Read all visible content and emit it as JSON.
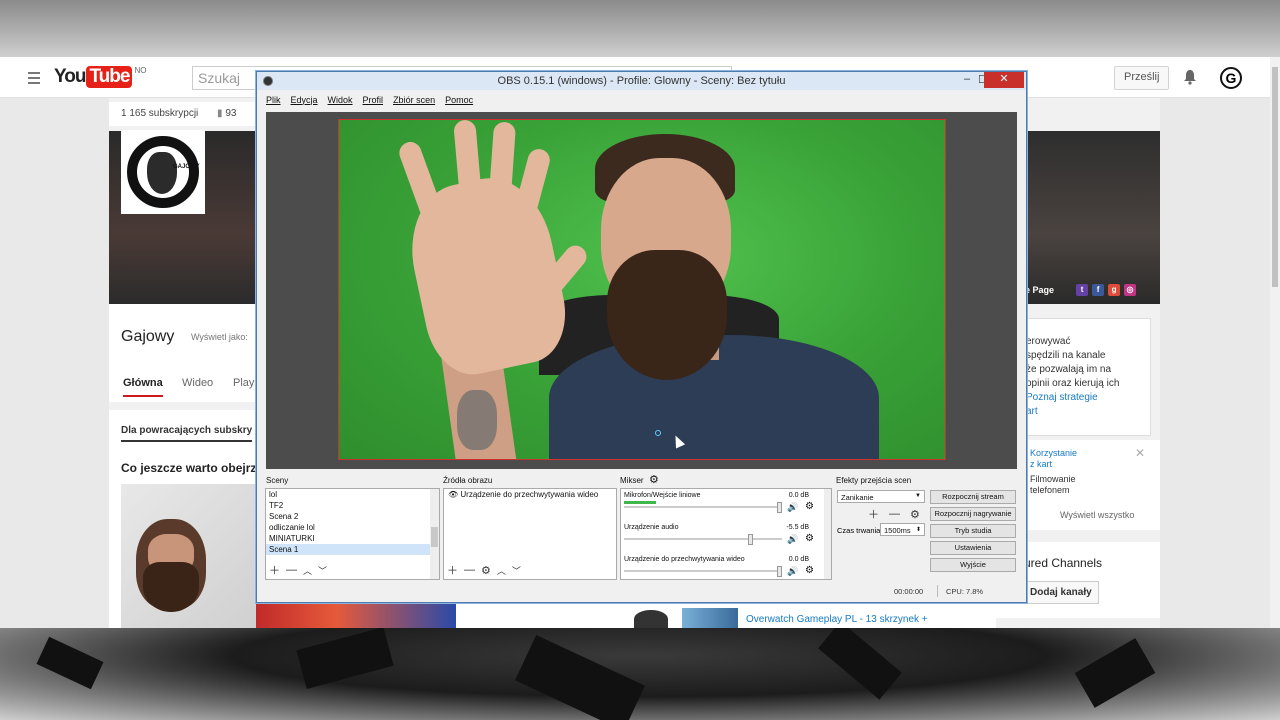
{
  "youtube": {
    "logo_you": "You",
    "logo_tube": "Tube",
    "logo_region": "NO",
    "search_placeholder": "Szukaj",
    "upload_label": "Prześlij",
    "avatar_letter": "G",
    "subscribers": "1 165 subskrypcji",
    "views_partial": "93",
    "channel_name": "Gajowy",
    "channel_logo_text": "GAJOWY",
    "view_as": "Wyświetl jako:",
    "tabs": [
      "Główna",
      "Wideo",
      "Play"
    ],
    "returning_tab": "Dla powracających subskry",
    "section_title": "Co jeszcze warto obejrz",
    "social_link": "e Page",
    "right_card_lines": [
      "erowywać",
      "spędzili na kanale",
      "że pozwalają im na",
      "opinii oraz kierują ich"
    ],
    "right_card_link": "Poznaj strategie",
    "right_card_link2": "art",
    "right_list_item1": [
      "Korzystanie",
      "z kart"
    ],
    "right_list_item2": [
      "Filmowanie",
      "telefonem"
    ],
    "right_list_all": "Wyświetl wszystko",
    "featured_title": "atured Channels",
    "featured_button": "Dodaj kanały",
    "video_title": "Overwatch Gameplay PL - 13 skrzynek +"
  },
  "obs": {
    "title": "OBS 0.15.1 (windows) - Profile: Glowny - Sceny: Bez tytułu",
    "menu": [
      "Plik",
      "Edycja",
      "Widok",
      "Profil",
      "Zbiór scen",
      "Pomoc"
    ],
    "panels": {
      "scenes_title": "Sceny",
      "sources_title": "Źródła obrazu",
      "mixer_title": "Mikser",
      "transitions_title": "Efekty przejścia scen"
    },
    "scenes": [
      "lol",
      "TF2",
      "Scena 2",
      "odliczanie lol",
      "MINIATURKI",
      "Scena 1"
    ],
    "selected_scene": "Scena 1",
    "sources": [
      "Urządzenie do przechwytywania wideo"
    ],
    "mixer": [
      {
        "name": "Mikrofon/Wejście liniowe",
        "db": "0.0 dB",
        "level": 0.2
      },
      {
        "name": "Urządzenie audio",
        "db": "-5.5 dB",
        "level": 0.0
      },
      {
        "name": "Urządzenie do przechwytywania wideo",
        "db": "0.0 dB",
        "level": 0.0
      }
    ],
    "transition": "Zanikanie",
    "duration_label": "Czas trwania",
    "duration_value": "1500ms",
    "buttons": [
      "Rozpocznij stream",
      "Rozpocznij nagrywanie",
      "Tryb studia",
      "Ustawienia",
      "Wyjście"
    ],
    "status_time": "00:00:00",
    "status_cpu": "CPU: 7.8%"
  },
  "colors": {
    "yt_red": "#e62117",
    "obs_border": "#4d7bb0",
    "greenscreen": "#3eab3e",
    "selection": "#d03030",
    "meter": "#3fb74b"
  }
}
